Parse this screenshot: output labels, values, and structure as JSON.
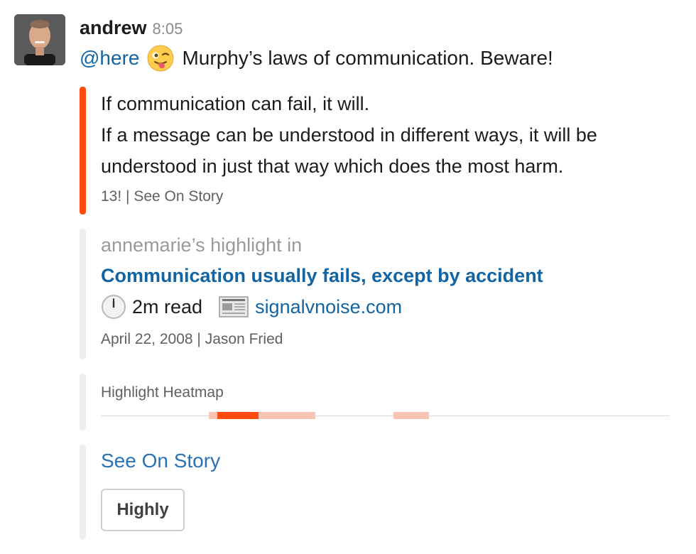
{
  "message": {
    "author": "andrew",
    "time": "8:05",
    "mention": "@here",
    "emoji": "winking-tongue-face",
    "text": "Murphy’s laws of communication. Beware!"
  },
  "quote": {
    "line1": "If communication can fail, it will.",
    "line2": "If a message can be understood in different ways, it will be understood in just that way which does the most harm.",
    "footer": "13! | See On Story"
  },
  "highlight": {
    "pretext": "annemarie’s highlight in",
    "title": "Communication usually fails, except by accident",
    "read_time": "2m read",
    "site": "signalvnoise.com",
    "date_author": "April 22, 2008 | Jason Fried"
  },
  "heatmap": {
    "title": "Highlight Heatmap",
    "segments": [
      {
        "start": 0.19,
        "end": 0.205,
        "intensity": "light"
      },
      {
        "start": 0.205,
        "end": 0.278,
        "intensity": "strong"
      },
      {
        "start": 0.278,
        "end": 0.378,
        "intensity": "light"
      },
      {
        "start": 0.515,
        "end": 0.578,
        "intensity": "light"
      }
    ],
    "colors": {
      "strong": "#ff4a10",
      "light": "#f8c4b4"
    }
  },
  "actions": {
    "see_on_story": "See On Story",
    "highly_button": "Highly"
  },
  "colors": {
    "accent": "#ff4a10",
    "link": "#1264a3"
  }
}
